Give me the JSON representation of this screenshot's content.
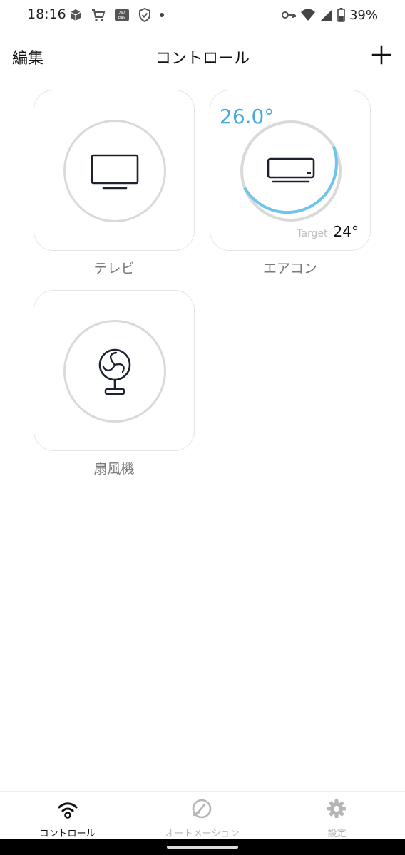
{
  "status_bar": {
    "time": "18:16",
    "battery": "39%",
    "icons": [
      "package-icon",
      "cart-icon",
      "au-pay-icon",
      "shield-icon",
      "dot-icon",
      "key-icon",
      "wifi-icon",
      "signal-icon",
      "battery-icon"
    ],
    "au_pay_text": "au\nPAY"
  },
  "header": {
    "edit_label": "編集",
    "title": "コントロール",
    "add_icon": "plus-icon"
  },
  "devices": [
    {
      "name": "テレビ",
      "icon": "tv-icon"
    },
    {
      "name": "エアコン",
      "icon": "air-conditioner-icon",
      "current_temp": "26.0°",
      "target_label": "Target",
      "target_temp": "24°",
      "accent": "#6ec4ec"
    },
    {
      "name": "扇風機",
      "icon": "fan-icon"
    }
  ],
  "bottom_nav": {
    "items": [
      {
        "label": "コントロール",
        "icon": "remote-wifi-icon",
        "active": true
      },
      {
        "label": "オートメーション",
        "icon": "automation-gauge-icon",
        "active": false
      },
      {
        "label": "設定",
        "icon": "gear-icon",
        "active": false
      }
    ]
  }
}
